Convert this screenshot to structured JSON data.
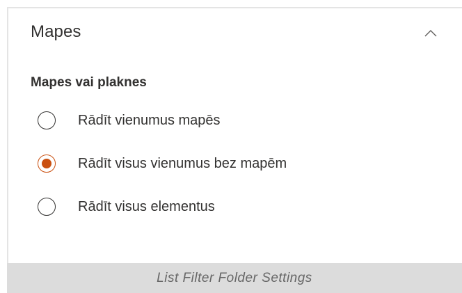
{
  "panel": {
    "title": "Mapes",
    "collapse_icon": "chevron-up-icon",
    "group_label": "Mapes vai plaknes",
    "options": [
      {
        "label": "Rādīt vienumus mapēs",
        "selected": false
      },
      {
        "label": "Rādīt visus vienumus bez mapēm",
        "selected": true
      },
      {
        "label": "Rādīt visus elementus",
        "selected": false
      }
    ]
  },
  "caption": "List Filter Folder Settings",
  "colors": {
    "accent": "#ca5010",
    "text": "#323130",
    "caption_bg": "#dcdcdc",
    "caption_text": "#666666"
  }
}
